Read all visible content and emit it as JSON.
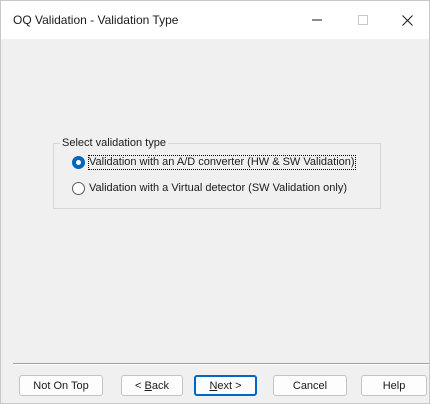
{
  "window": {
    "title": "OQ Validation - Validation Type"
  },
  "titlebar_buttons": {
    "minimize_icon": "minimize-icon",
    "maximize_icon": "maximize-icon",
    "close_icon": "close-icon"
  },
  "group": {
    "legend": "Select validation type",
    "options": [
      {
        "label": "Validation with an A/D converter (HW & SW Validation)",
        "checked": true
      },
      {
        "label": "Validation with a Virtual detector (SW Validation only)",
        "checked": false
      }
    ]
  },
  "buttons": {
    "not_on_top": "Not On Top",
    "back_prefix": "< ",
    "back_mnemonic": "B",
    "back_rest": "ack",
    "next_mnemonic": "N",
    "next_rest": "ext >",
    "cancel": "Cancel",
    "help": "Help"
  },
  "colors": {
    "accent": "#0067c0",
    "background": "#f0f0f0"
  }
}
